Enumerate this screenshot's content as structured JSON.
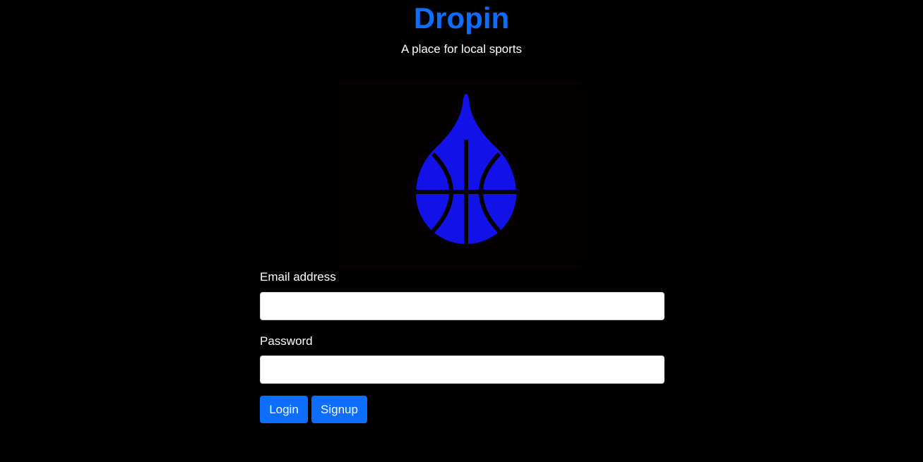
{
  "header": {
    "title": "Dropin",
    "subtitle": "A place for local sports"
  },
  "logo": {
    "icon": "basketball-drop-icon",
    "color": "#1212e8",
    "background": "#050102"
  },
  "form": {
    "email_label": "Email address",
    "email_value": "",
    "password_label": "Password",
    "password_value": "",
    "login_label": "Login",
    "signup_label": "Signup"
  },
  "colors": {
    "accent": "#0d6efd",
    "background": "#000000",
    "text": "#ffffff"
  }
}
